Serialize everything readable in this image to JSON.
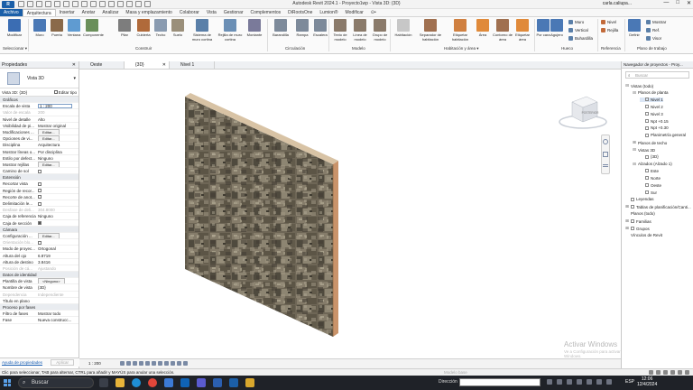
{
  "titlebar": {
    "logo": "R",
    "title": "Autodesk Revit 2024.1 - Proyecto1wp - Vista 3D: {3D}",
    "user": "carla.caliupa...",
    "minimize": "—",
    "maximize": "□",
    "close": "✕"
  },
  "ribbon_tabs": [
    "Archivo",
    "Arquitectura",
    "Insertar",
    "Anotar",
    "Analizar",
    "Masa y emplazamiento",
    "Colaborar",
    "Vista",
    "Gestionar",
    "Complementos",
    "DiRootsOne",
    "Lumion®",
    "Modificar",
    "⊙•"
  ],
  "ribbon": {
    "modify": "Modificar",
    "select": "Seleccionar ▾",
    "build_buttons": [
      "Muro",
      "Puerta",
      "Ventana",
      "Componente",
      "Pilar",
      "Cubierta",
      "Techo",
      "Suelo",
      "Sistema de muro cortina",
      "Rejilla de muro cortina",
      "Montante"
    ],
    "build_label": "Construir",
    "circulation_buttons": [
      "Barandilla",
      "Rampa",
      "Escalera"
    ],
    "circulation_label": "Circulación",
    "model_buttons": [
      "Texto de modelo",
      "Línea de modelo",
      "Grupo de modelo"
    ],
    "model_label": "Modelo",
    "room_buttons": [
      "Habitación",
      "Separador de habitación",
      "Etiquetar habitación",
      "Área",
      "Contorno de área",
      "Etiquetar área"
    ],
    "room_label": "Habitación y área ▾",
    "opening_buttons": [
      "Por cara",
      "Agujero"
    ],
    "opening_small": [
      "Muro",
      "Vertical",
      "Buhardilla"
    ],
    "opening_label": "Hueco",
    "datum_small": [
      "Nivel",
      "Rejilla"
    ],
    "datum_label": "Referencia",
    "workplane_buttons": [
      "Definir"
    ],
    "workplane_small": [
      "Mostrar",
      "Ref.",
      "Visor"
    ],
    "workplane_label": "Plano de trabajo"
  },
  "properties": {
    "title": "Propiedades",
    "close": "✕",
    "type_name": "Vista 3D",
    "instance": "Vista 3D: {3D}",
    "edit_type": "Editar tipo",
    "rows": [
      {
        "k": "Gráficos",
        "v": "",
        "kind": "sec"
      },
      {
        "k": "Escala de vista",
        "v": "1 : 200",
        "kind": "input"
      },
      {
        "k": "Valor de escala",
        "v": "200",
        "kind": "dis"
      },
      {
        "k": "Nivel de detalle",
        "v": "Alto",
        "kind": ""
      },
      {
        "k": "Visibilidad de pi...",
        "v": "Mostrar original",
        "kind": ""
      },
      {
        "k": "Modificaciones ...",
        "v": "Editar...",
        "kind": "btn"
      },
      {
        "k": "Opciones de vi...",
        "v": "Editar...",
        "kind": "btn"
      },
      {
        "k": "Disciplina",
        "v": "Arquitectura",
        "kind": ""
      },
      {
        "k": "Mostrar líneas o...",
        "v": "Por disciplina",
        "kind": ""
      },
      {
        "k": "Estilo por defect...",
        "v": "Ninguno",
        "kind": ""
      },
      {
        "k": "Mostrar rejillas",
        "v": "Editar...",
        "kind": "btn"
      },
      {
        "k": "Camino de sol",
        "v": "",
        "kind": "chk"
      },
      {
        "k": "Extensión",
        "v": "",
        "kind": "sec"
      },
      {
        "k": "Recortar vista",
        "v": "",
        "kind": "chk"
      },
      {
        "k": "Región de recor...",
        "v": "",
        "kind": "chk"
      },
      {
        "k": "Recorte de anot...",
        "v": "",
        "kind": "chk"
      },
      {
        "k": "Delimitación le...",
        "v": "",
        "kind": "chk"
      },
      {
        "k": "Desfase de deli...",
        "v": "304.8000",
        "kind": "dis"
      },
      {
        "k": "Caja de referencia",
        "v": "Ninguno",
        "kind": ""
      },
      {
        "k": "Caja de sección",
        "v": "",
        "kind": "chkon"
      },
      {
        "k": "Cámara",
        "v": "",
        "kind": "sec"
      },
      {
        "k": "Configuración ...",
        "v": "Editar...",
        "kind": "btn"
      },
      {
        "k": "Orientación blo...",
        "v": "",
        "kind": "dischk"
      },
      {
        "k": "Modo de proyec...",
        "v": "Ortogonal",
        "kind": ""
      },
      {
        "k": "Altura del ojo",
        "v": "6.8719",
        "kind": ""
      },
      {
        "k": "Altura de destino",
        "v": "3.8416",
        "kind": ""
      },
      {
        "k": "Posición de cá...",
        "v": "Ajustando",
        "kind": "dis"
      },
      {
        "k": "Datos de identidad",
        "v": "",
        "kind": "sec"
      },
      {
        "k": "Plantilla de vista",
        "v": "<Ninguno>",
        "kind": "btn"
      },
      {
        "k": "Nombre de vista",
        "v": "{3D}",
        "kind": ""
      },
      {
        "k": "Dependencia",
        "v": "Independiente",
        "kind": "dis"
      },
      {
        "k": "Título en plano",
        "v": "",
        "kind": ""
      },
      {
        "k": "Proceso por fases",
        "v": "",
        "kind": "sec"
      },
      {
        "k": "Filtro de fases",
        "v": "Mostrar todo",
        "kind": ""
      },
      {
        "k": "Fase",
        "v": "Nueva construcc...",
        "kind": ""
      }
    ],
    "help_link": "Ayuda de propiedades",
    "apply": "Aplicar"
  },
  "view_tabs": [
    {
      "label": "Oeste",
      "active": false
    },
    {
      "label": "{3D}",
      "active": true,
      "close": "✕"
    },
    {
      "label": "Nivel 1",
      "active": false
    }
  ],
  "canvas": {
    "viewcube_label": "POSTERIOR",
    "watermark": "Activar Windows",
    "watermark_sub": "Ve a Configuración para activar Windows."
  },
  "view_control": {
    "scale": "1 : 200"
  },
  "browser": {
    "title": "Navegador de proyectos - Proy...",
    "search_placeholder": "Buscar",
    "nodes": [
      {
        "label": "Vistas (todo)",
        "level": 0,
        "toggle": "⊟",
        "box": false
      },
      {
        "label": "Planos de planta",
        "level": 1,
        "toggle": "⊟",
        "box": false
      },
      {
        "label": "Nivel 1",
        "level": 2,
        "toggle": "",
        "box": true,
        "sel": true
      },
      {
        "label": "Nivel 2",
        "level": 2,
        "toggle": "",
        "box": true
      },
      {
        "label": "Nivel 3",
        "level": 2,
        "toggle": "",
        "box": true
      },
      {
        "label": "Npt +0.15",
        "level": 2,
        "toggle": "",
        "box": true
      },
      {
        "label": "Npt +0.30",
        "level": 2,
        "toggle": "",
        "box": true
      },
      {
        "label": "Planimetría general",
        "level": 2,
        "toggle": "",
        "box": true
      },
      {
        "label": "Planos de techo",
        "level": 1,
        "toggle": "⊞",
        "box": false
      },
      {
        "label": "Vistas 3D",
        "level": 1,
        "toggle": "⊟",
        "box": false
      },
      {
        "label": "{3D}",
        "level": 2,
        "toggle": "",
        "box": true
      },
      {
        "label": "Alzados (Alzado 1)",
        "level": 1,
        "toggle": "⊟",
        "box": false
      },
      {
        "label": "Este",
        "level": 2,
        "toggle": "",
        "box": true
      },
      {
        "label": "Norte",
        "level": 2,
        "toggle": "",
        "box": true
      },
      {
        "label": "Oeste",
        "level": 2,
        "toggle": "",
        "box": true
      },
      {
        "label": "Sur",
        "level": 2,
        "toggle": "",
        "box": true
      },
      {
        "label": "Leyendas",
        "level": 0,
        "toggle": "",
        "box": true
      },
      {
        "label": "Tablas de planificación/Canti...",
        "level": 0,
        "toggle": "⊞",
        "box": true
      },
      {
        "label": "Planos (todo)",
        "level": 0,
        "toggle": "",
        "box": false
      },
      {
        "label": "Familias",
        "level": 0,
        "toggle": "⊞",
        "box": true
      },
      {
        "label": "Grupos",
        "level": 0,
        "toggle": "⊞",
        "box": true
      },
      {
        "label": "Vínculos de Revit",
        "level": 0,
        "toggle": "",
        "box": false
      }
    ]
  },
  "status": {
    "message": "Clic para seleccionar, TAB para alternar, CTRL para añadir y MAYÚS para anular una selección.",
    "main_model": "Modelo base"
  },
  "taskbar": {
    "search": "Buscar",
    "address_label": "Dirección",
    "lang": "ESP",
    "time": "12:06",
    "date": "12/4/2024"
  },
  "colors": {
    "accent": "#1b5fa8",
    "wall_face": "#6e6656",
    "wall_side": "#c9936a"
  }
}
